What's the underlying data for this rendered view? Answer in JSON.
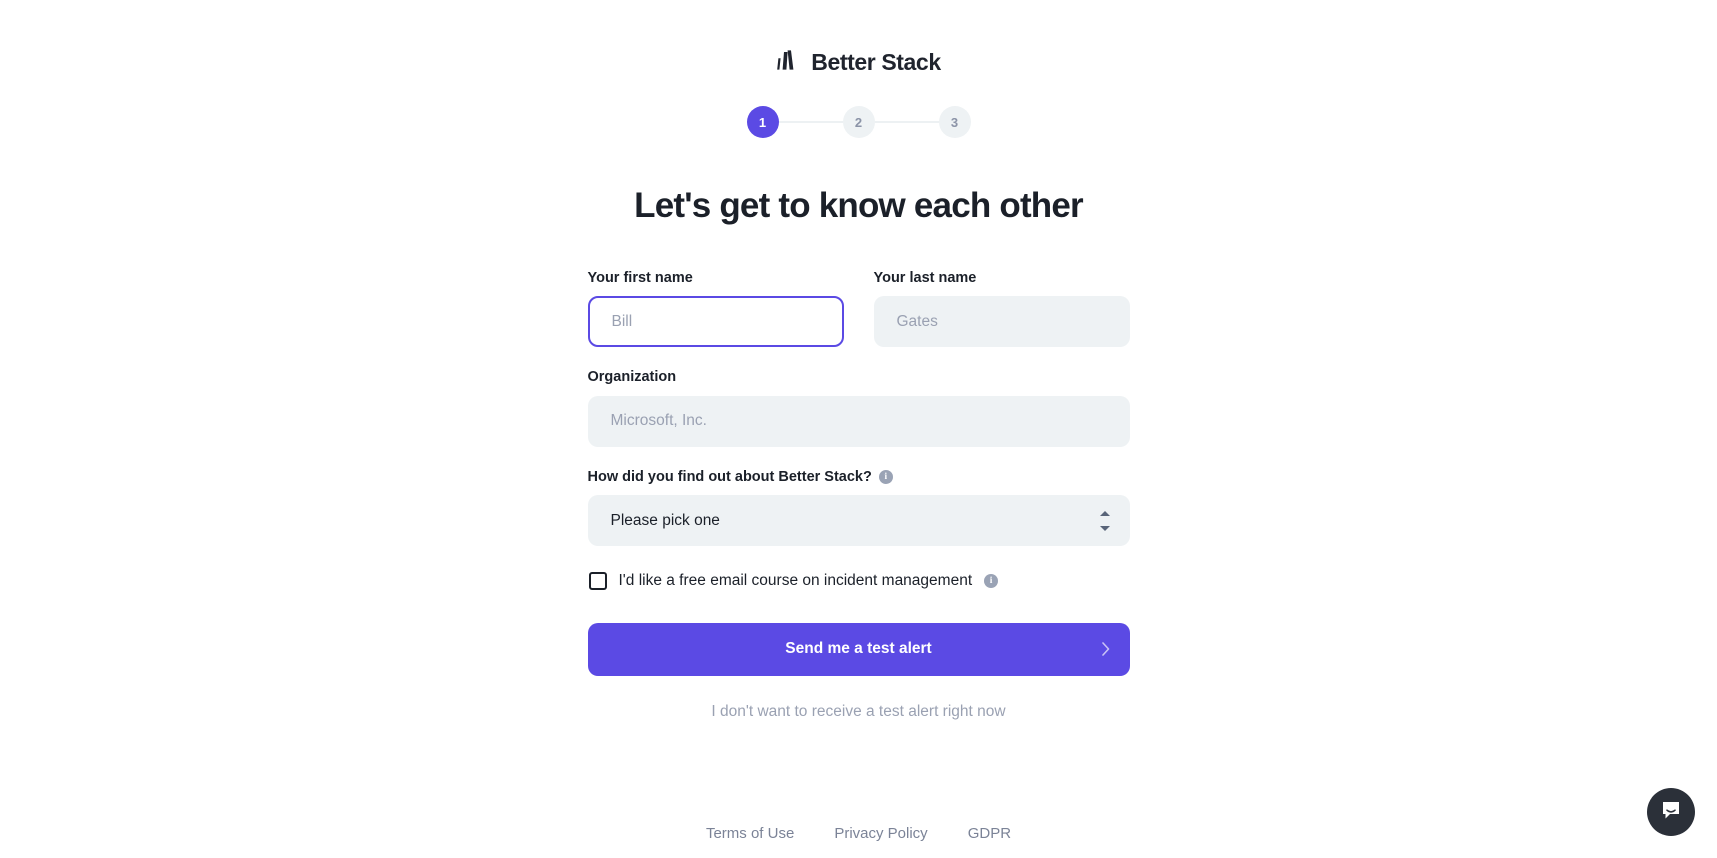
{
  "brand": {
    "name": "Better Stack",
    "logo_icon": "better-stack-bars-icon",
    "accent_color": "#5b4ae4",
    "text_color": "#1b2029",
    "field_bg_color": "#eef2f4"
  },
  "stepper": {
    "steps": [
      {
        "label": "1",
        "state": "active"
      },
      {
        "label": "2",
        "state": "inactive"
      },
      {
        "label": "3",
        "state": "inactive"
      }
    ]
  },
  "headline": "Let's get to know each other",
  "form": {
    "first_name": {
      "label": "Your first name",
      "placeholder": "Bill",
      "value": "",
      "focused": true
    },
    "last_name": {
      "label": "Your last name",
      "placeholder": "Gates",
      "value": "",
      "focused": false
    },
    "organization": {
      "label": "Organization",
      "placeholder": "Microsoft, Inc.",
      "value": "",
      "focused": false
    },
    "referral": {
      "label": "How did you find out about Better Stack?",
      "info_icon": "info-icon",
      "selected": "Please pick one",
      "options": [
        "Please pick one"
      ]
    },
    "email_course": {
      "label": "I'd like a free email course on incident management",
      "checked": false,
      "info_icon": "info-icon"
    },
    "submit_label": "Send me a test alert",
    "submit_icon": "chevron-right-icon",
    "skip_label": "I don't want to receive a test alert right now"
  },
  "footer": {
    "links": [
      {
        "label": "Terms of Use"
      },
      {
        "label": "Privacy Policy"
      },
      {
        "label": "GDPR"
      }
    ]
  },
  "chat_widget": {
    "icon": "chat-bubble-icon",
    "background_color": "#2b3039"
  }
}
